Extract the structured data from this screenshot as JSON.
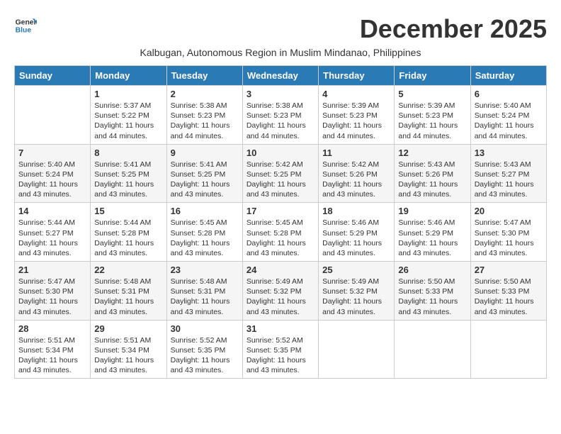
{
  "header": {
    "logo_line1": "General",
    "logo_line2": "Blue",
    "month_title": "December 2025",
    "subtitle": "Kalbugan, Autonomous Region in Muslim Mindanao, Philippines"
  },
  "days_of_week": [
    "Sunday",
    "Monday",
    "Tuesday",
    "Wednesday",
    "Thursday",
    "Friday",
    "Saturday"
  ],
  "weeks": [
    [
      {
        "day": "",
        "info": ""
      },
      {
        "day": "1",
        "info": "Sunrise: 5:37 AM\nSunset: 5:22 PM\nDaylight: 11 hours\nand 44 minutes."
      },
      {
        "day": "2",
        "info": "Sunrise: 5:38 AM\nSunset: 5:23 PM\nDaylight: 11 hours\nand 44 minutes."
      },
      {
        "day": "3",
        "info": "Sunrise: 5:38 AM\nSunset: 5:23 PM\nDaylight: 11 hours\nand 44 minutes."
      },
      {
        "day": "4",
        "info": "Sunrise: 5:39 AM\nSunset: 5:23 PM\nDaylight: 11 hours\nand 44 minutes."
      },
      {
        "day": "5",
        "info": "Sunrise: 5:39 AM\nSunset: 5:23 PM\nDaylight: 11 hours\nand 44 minutes."
      },
      {
        "day": "6",
        "info": "Sunrise: 5:40 AM\nSunset: 5:24 PM\nDaylight: 11 hours\nand 44 minutes."
      }
    ],
    [
      {
        "day": "7",
        "info": "Sunrise: 5:40 AM\nSunset: 5:24 PM\nDaylight: 11 hours\nand 43 minutes."
      },
      {
        "day": "8",
        "info": "Sunrise: 5:41 AM\nSunset: 5:25 PM\nDaylight: 11 hours\nand 43 minutes."
      },
      {
        "day": "9",
        "info": "Sunrise: 5:41 AM\nSunset: 5:25 PM\nDaylight: 11 hours\nand 43 minutes."
      },
      {
        "day": "10",
        "info": "Sunrise: 5:42 AM\nSunset: 5:25 PM\nDaylight: 11 hours\nand 43 minutes."
      },
      {
        "day": "11",
        "info": "Sunrise: 5:42 AM\nSunset: 5:26 PM\nDaylight: 11 hours\nand 43 minutes."
      },
      {
        "day": "12",
        "info": "Sunrise: 5:43 AM\nSunset: 5:26 PM\nDaylight: 11 hours\nand 43 minutes."
      },
      {
        "day": "13",
        "info": "Sunrise: 5:43 AM\nSunset: 5:27 PM\nDaylight: 11 hours\nand 43 minutes."
      }
    ],
    [
      {
        "day": "14",
        "info": "Sunrise: 5:44 AM\nSunset: 5:27 PM\nDaylight: 11 hours\nand 43 minutes."
      },
      {
        "day": "15",
        "info": "Sunrise: 5:44 AM\nSunset: 5:28 PM\nDaylight: 11 hours\nand 43 minutes."
      },
      {
        "day": "16",
        "info": "Sunrise: 5:45 AM\nSunset: 5:28 PM\nDaylight: 11 hours\nand 43 minutes."
      },
      {
        "day": "17",
        "info": "Sunrise: 5:45 AM\nSunset: 5:28 PM\nDaylight: 11 hours\nand 43 minutes."
      },
      {
        "day": "18",
        "info": "Sunrise: 5:46 AM\nSunset: 5:29 PM\nDaylight: 11 hours\nand 43 minutes."
      },
      {
        "day": "19",
        "info": "Sunrise: 5:46 AM\nSunset: 5:29 PM\nDaylight: 11 hours\nand 43 minutes."
      },
      {
        "day": "20",
        "info": "Sunrise: 5:47 AM\nSunset: 5:30 PM\nDaylight: 11 hours\nand 43 minutes."
      }
    ],
    [
      {
        "day": "21",
        "info": "Sunrise: 5:47 AM\nSunset: 5:30 PM\nDaylight: 11 hours\nand 43 minutes."
      },
      {
        "day": "22",
        "info": "Sunrise: 5:48 AM\nSunset: 5:31 PM\nDaylight: 11 hours\nand 43 minutes."
      },
      {
        "day": "23",
        "info": "Sunrise: 5:48 AM\nSunset: 5:31 PM\nDaylight: 11 hours\nand 43 minutes."
      },
      {
        "day": "24",
        "info": "Sunrise: 5:49 AM\nSunset: 5:32 PM\nDaylight: 11 hours\nand 43 minutes."
      },
      {
        "day": "25",
        "info": "Sunrise: 5:49 AM\nSunset: 5:32 PM\nDaylight: 11 hours\nand 43 minutes."
      },
      {
        "day": "26",
        "info": "Sunrise: 5:50 AM\nSunset: 5:33 PM\nDaylight: 11 hours\nand 43 minutes."
      },
      {
        "day": "27",
        "info": "Sunrise: 5:50 AM\nSunset: 5:33 PM\nDaylight: 11 hours\nand 43 minutes."
      }
    ],
    [
      {
        "day": "28",
        "info": "Sunrise: 5:51 AM\nSunset: 5:34 PM\nDaylight: 11 hours\nand 43 minutes."
      },
      {
        "day": "29",
        "info": "Sunrise: 5:51 AM\nSunset: 5:34 PM\nDaylight: 11 hours\nand 43 minutes."
      },
      {
        "day": "30",
        "info": "Sunrise: 5:52 AM\nSunset: 5:35 PM\nDaylight: 11 hours\nand 43 minutes."
      },
      {
        "day": "31",
        "info": "Sunrise: 5:52 AM\nSunset: 5:35 PM\nDaylight: 11 hours\nand 43 minutes."
      },
      {
        "day": "",
        "info": ""
      },
      {
        "day": "",
        "info": ""
      },
      {
        "day": "",
        "info": ""
      }
    ]
  ]
}
